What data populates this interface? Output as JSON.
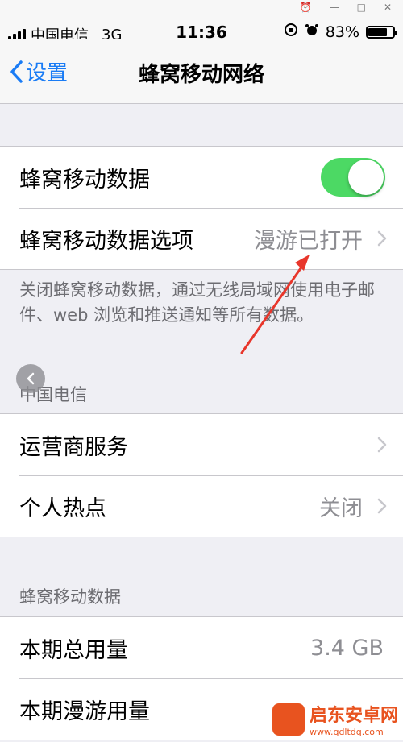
{
  "status_bar": {
    "carrier": "中国电信",
    "network": "3G",
    "time": "11:36",
    "battery_percent": "83%",
    "battery_level": 0.83
  },
  "nav": {
    "back_label": "设置",
    "title": "蜂窝移动网络"
  },
  "group1": {
    "cellular_data_label": "蜂窝移动数据",
    "cellular_data_on": true,
    "options_label": "蜂窝移动数据选项",
    "options_value": "漫游已打开"
  },
  "footer_text": "关闭蜂窝移动数据，通过无线局域网使用电子邮件、web 浏览和推送通知等所有数据。",
  "carrier_section": {
    "header": "中国电信",
    "carrier_services_label": "运营商服务",
    "hotspot_label": "个人热点",
    "hotspot_value": "关闭"
  },
  "usage_section": {
    "header": "蜂窝移动数据",
    "current_period_label": "本期总用量",
    "current_period_value": "3.4 GB",
    "roaming_label": "本期漫游用量"
  },
  "watermark": {
    "name": "启东安卓网",
    "url": "www.qdltdq.com"
  },
  "colors": {
    "accent": "#1a7cf5",
    "toggle_on": "#4cd964",
    "annotation_arrow": "#e8362b",
    "watermark": "#e8531f"
  }
}
